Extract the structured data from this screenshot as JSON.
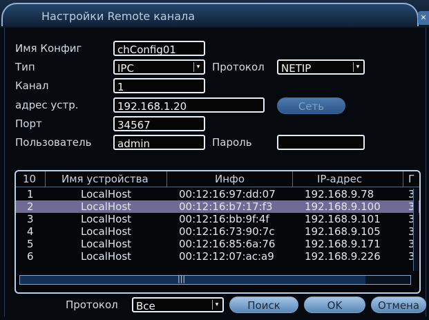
{
  "window": {
    "title": "Настройки Remote канала",
    "close_glyph": "✕"
  },
  "form": {
    "config_name_label": "Имя Конфиг",
    "config_name_value": "chConfig01",
    "type_label": "Тип",
    "type_value": "IPC",
    "protocol_label": "Протокол",
    "protocol_value": "NETIP",
    "channel_label": "Канал",
    "channel_value": "1",
    "address_label": "адрес устр.",
    "address_value": "192.168.1.20",
    "network_button": "Сеть",
    "port_label": "Порт",
    "port_value": "34567",
    "user_label": "Пользователь",
    "user_value": "admin",
    "password_label": "Пароль",
    "password_value": ""
  },
  "table": {
    "headers": [
      "10",
      "Имя устройства",
      "Инфо",
      "IP-адрес",
      "Г"
    ],
    "rows": [
      [
        "1",
        "LocalHost",
        "00:12:16:97:dd:07",
        "192.168.9.78",
        "3"
      ],
      [
        "2",
        "LocalHost",
        "00:12:16:b7:17:f3",
        "192.168.9.100",
        "3"
      ],
      [
        "3",
        "LocalHost",
        "00:12:16:bb:9f:4f",
        "192.168.9.101",
        "3"
      ],
      [
        "4",
        "LocalHost",
        "00:12:16:73:90:7c",
        "192.168.9.105",
        "3"
      ],
      [
        "5",
        "LocalHost",
        "00:12:16:85:6a:76",
        "192.168.9.171",
        "3"
      ],
      [
        "6",
        "LocalHost",
        "00:12:12:07:ac:a9",
        "192.168.9.226",
        "3"
      ]
    ],
    "selected_row": 2,
    "hscroll_grip": "|||"
  },
  "footer": {
    "protocol_label": "Протокол",
    "protocol_value": "Все",
    "search_button": "Поиск",
    "ok_button": "OK",
    "cancel_button": "Отмена"
  },
  "icons": {
    "dropdown": "chevron-down-icon",
    "close": "close-icon"
  },
  "colors": {
    "accent": "#5b87b6",
    "selected_row": "#6f6b93",
    "background": "#060b12"
  }
}
